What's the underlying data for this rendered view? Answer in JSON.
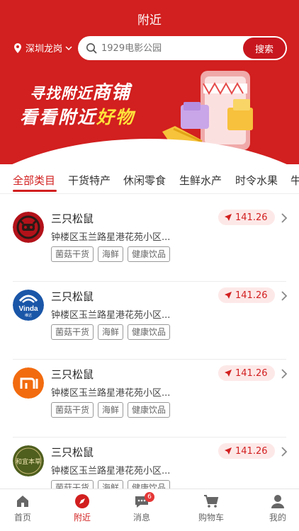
{
  "header": {
    "title": "附近",
    "location": "深圳龙岗",
    "search": {
      "placeholder": "1929电影公园",
      "button_label": "搜索"
    },
    "banner": {
      "line1_prefix": "寻找附近",
      "line1_highlight": "商铺",
      "line2_prefix": "看看附近",
      "line2_highlight": "好物"
    }
  },
  "categories": {
    "items": [
      "全部类目",
      "干货特产",
      "休闲零食",
      "生鲜水产",
      "时令水果",
      "牛"
    ],
    "active_index": 0
  },
  "shops": [
    {
      "name": "三只松鼠",
      "address": "钟楼区玉兰路星港花苑小区...",
      "distance": "141.26",
      "tags": [
        "菌菇干货",
        "海鲜",
        "健康饮品"
      ],
      "logo": "squirrel-logo"
    },
    {
      "name": "三只松鼠",
      "address": "钟楼区玉兰路星港花苑小区...",
      "distance": "141.26",
      "tags": [
        "菌菇干货",
        "海鲜",
        "健康饮品"
      ],
      "logo": "vinda-logo"
    },
    {
      "name": "三只松鼠",
      "address": "钟楼区玉兰路星港花苑小区...",
      "distance": "141.26",
      "tags": [
        "菌菇干货",
        "海鲜",
        "健康饮品"
      ],
      "logo": "mi-logo"
    },
    {
      "name": "三只松鼠",
      "address": "钟楼区玉兰路星港花苑小区...",
      "distance": "141.26",
      "tags": [
        "菌菇干货",
        "海鲜",
        "健康饮品"
      ],
      "logo": "tea-logo"
    }
  ],
  "logos": {
    "vinda_text": "Vinda",
    "vinda_sub": "维达",
    "tea_text": "和宜本草"
  },
  "tabbar": {
    "items": [
      {
        "label": "首页",
        "icon": "home-icon"
      },
      {
        "label": "附近",
        "icon": "compass-icon"
      },
      {
        "label": "消息",
        "icon": "message-icon",
        "badge": "6"
      },
      {
        "label": "购物车",
        "icon": "cart-icon"
      },
      {
        "label": "我的",
        "icon": "user-icon"
      }
    ],
    "active_index": 1
  },
  "colors": {
    "brand": "#d21f1f",
    "badge": "#e63737",
    "distance_bg": "#fde8e8"
  }
}
